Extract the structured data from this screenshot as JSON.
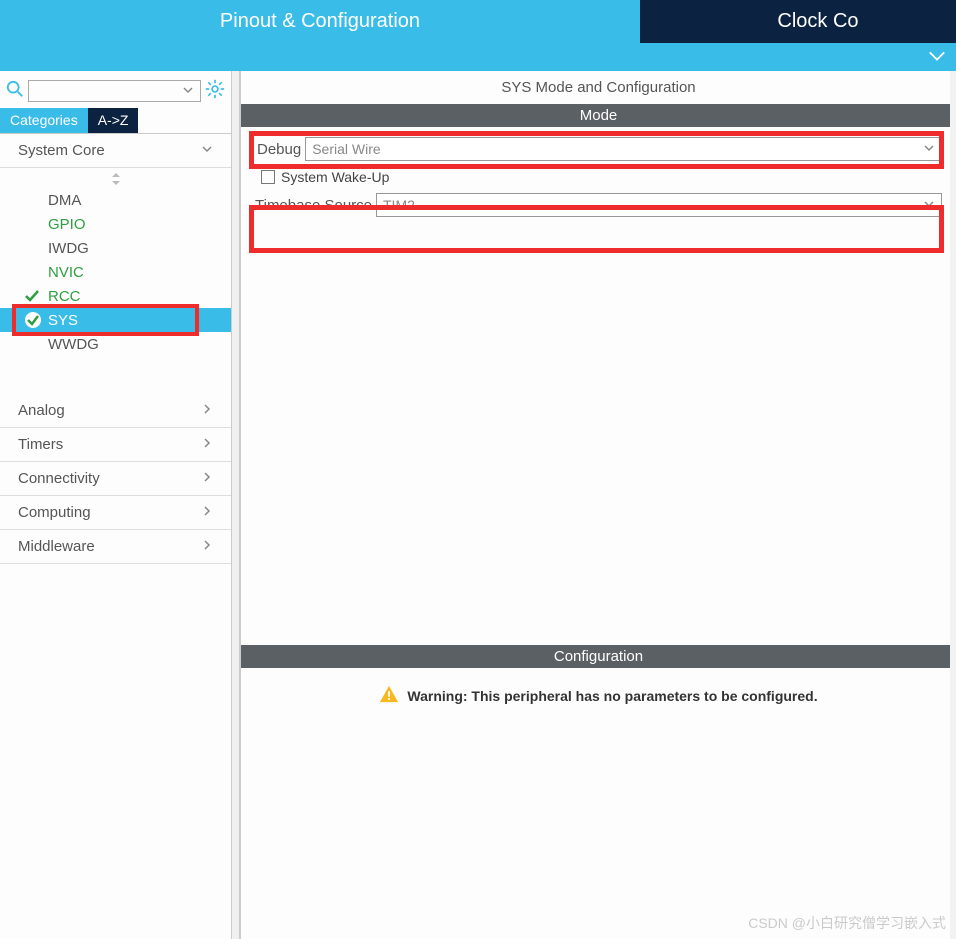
{
  "topTabs": {
    "active": "Pinout & Configuration",
    "inactive": "Clock Co"
  },
  "sidebar": {
    "tabs": {
      "categories": "Categories",
      "az": "A->Z"
    },
    "group_system_core": "System Core",
    "items": {
      "dma": "DMA",
      "gpio": "GPIO",
      "iwdg": "IWDG",
      "nvic": "NVIC",
      "rcc": "RCC",
      "sys": "SYS",
      "wwdg": "WWDG"
    },
    "group_analog": "Analog",
    "group_timers": "Timers",
    "group_connectivity": "Connectivity",
    "group_computing": "Computing",
    "group_middleware": "Middleware"
  },
  "main": {
    "title": "SYS Mode and Configuration",
    "mode_header": "Mode",
    "debug_label": "Debug",
    "debug_value": "Serial Wire",
    "wakeup_label": "System Wake-Up",
    "timebase_label": "Timebase Source",
    "timebase_value": "TIM2",
    "config_header": "Configuration",
    "warning": "Warning: This peripheral has no parameters to be configured."
  },
  "watermark": "CSDN @小白研究僧学习嵌入式"
}
